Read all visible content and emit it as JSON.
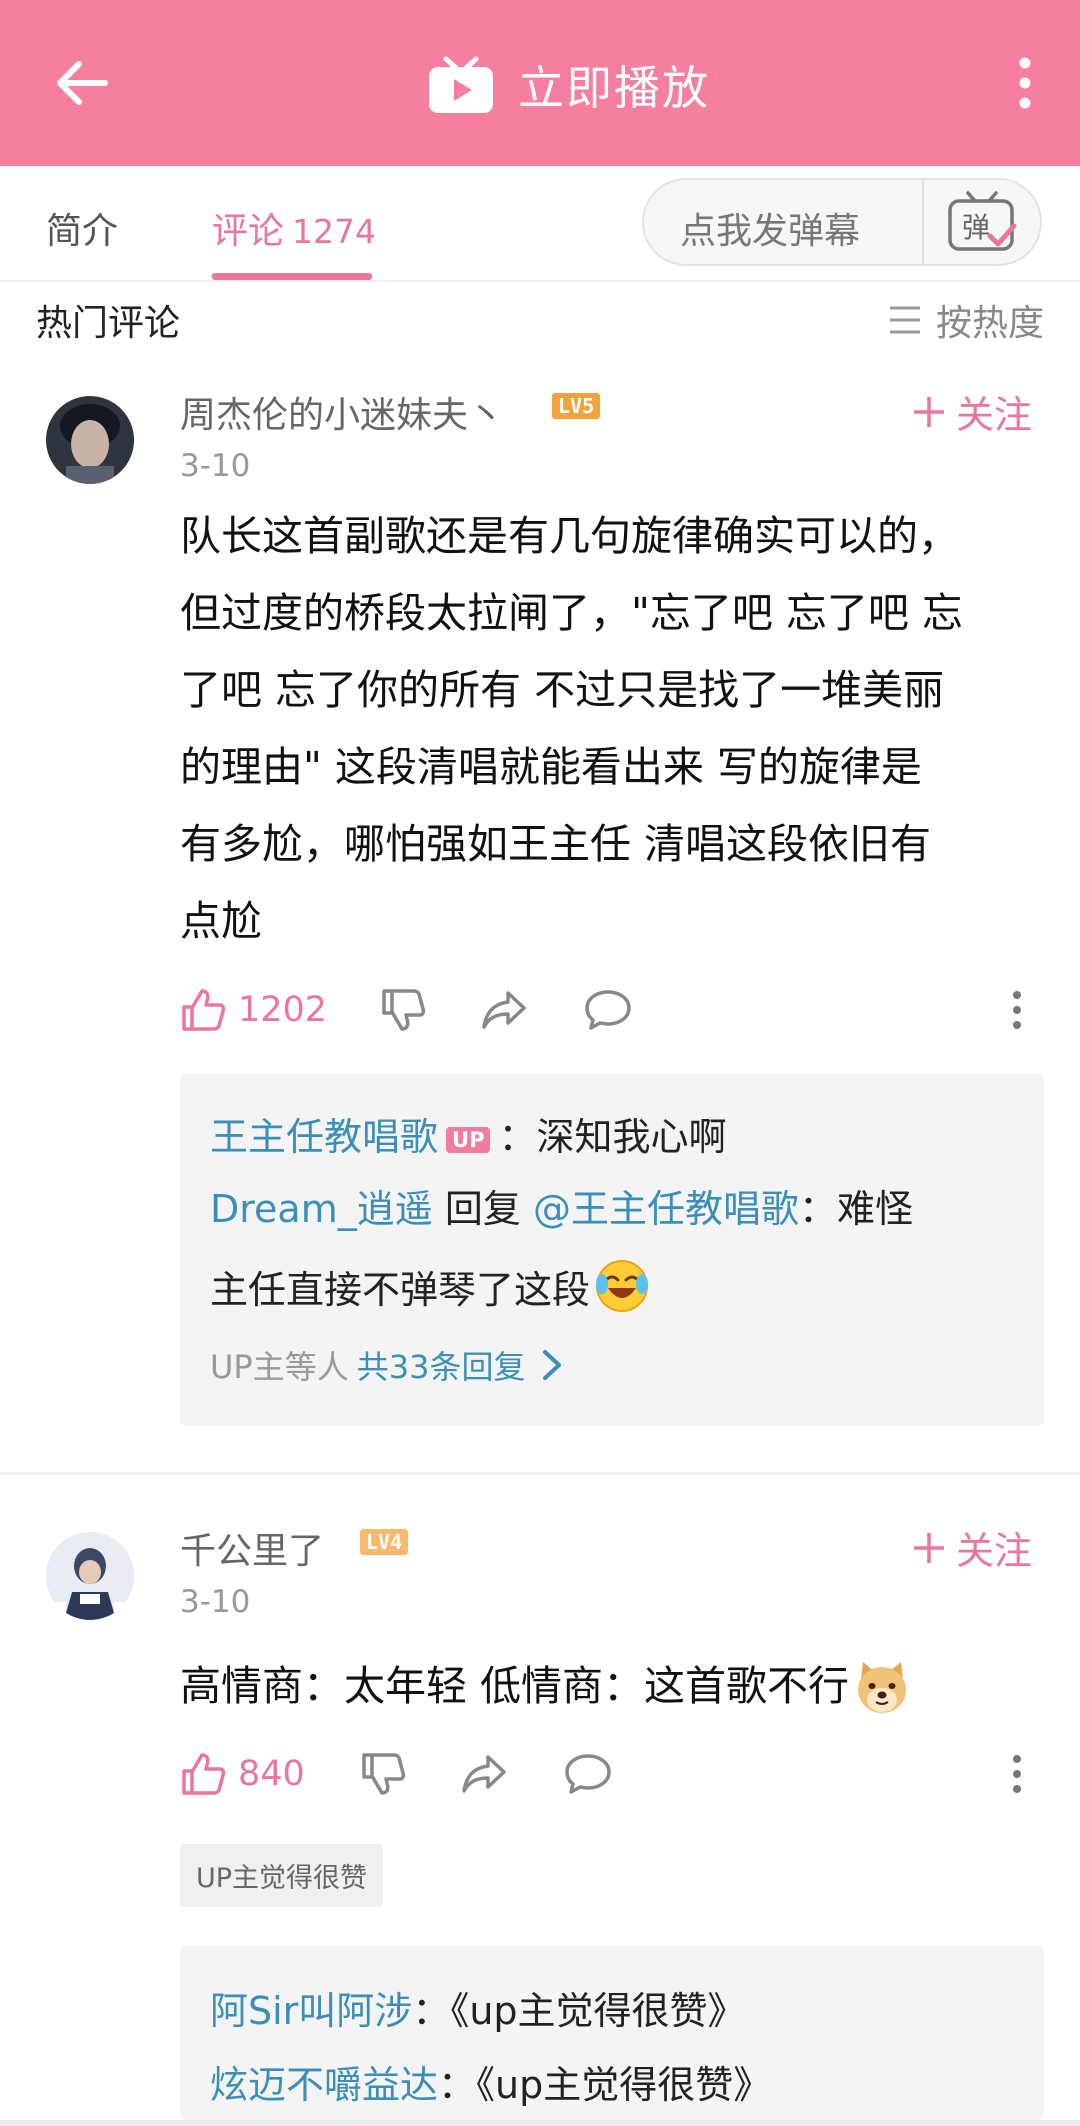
{
  "header": {
    "title": "立即播放"
  },
  "tabs": {
    "intro": "简介",
    "comments": "评论",
    "comments_count": "1274"
  },
  "danmaku": {
    "placeholder": "点我发弹幕",
    "icon_label": "弹"
  },
  "hot": {
    "title": "热门评论",
    "sort": "按热度"
  },
  "comments": [
    {
      "username": "周杰伦的小迷妹夫丶",
      "level": "LV5",
      "date": "3-10",
      "follow": "关注",
      "text_lines": [
        "队长这首副歌还是有几句旋律确实可以的，",
        "但过度的桥段太拉闸了，\"忘了吧 忘了吧 忘",
        "了吧 忘了你的所有  不过只是找了一堆美丽",
        "的理由\"  这段清唱就能看出来  写的旋律是",
        "有多尬，哪怕强如王主任  清唱这段依旧有",
        "点尬"
      ],
      "likes": "1202",
      "replies": [
        {
          "user": "王主任教唱歌",
          "badge": "UP",
          "text": "：深知我心啊"
        },
        {
          "user": "Dream_逍遥",
          "reply_word": "回复",
          "mention": "@王主任教唱歌",
          "text": "：难怪"
        },
        {
          "text": "主任直接不弹琴了这段"
        }
      ],
      "replies_prefix": "UP主等人",
      "replies_total": "共33条回复"
    },
    {
      "username": "千公里了",
      "level": "LV4",
      "date": "3-10",
      "follow": "关注",
      "text": "高情商：太年轻 低情商：这首歌不行",
      "likes": "840",
      "tag": "UP主觉得很赞",
      "replies": [
        {
          "user": "阿Sir叫阿涉",
          "text": "：《up主觉得很赞》"
        },
        {
          "user": "炫迈不嚼益达",
          "text": "：《up主觉得很赞》"
        }
      ]
    }
  ],
  "colors": {
    "brand_pink": "#f67fa0",
    "accent": "#e9779a",
    "link_blue": "#3b8fb6",
    "level5": "#f4a23c",
    "level4": "#f8b96c"
  }
}
